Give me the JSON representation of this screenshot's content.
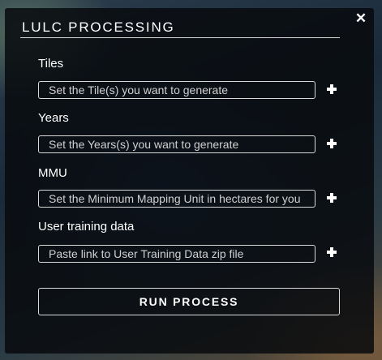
{
  "dialog": {
    "title": "LULC PROCESSING",
    "close_icon": "close-icon"
  },
  "fields": [
    {
      "label": "Tiles",
      "placeholder": "Set the Tile(s) you want to generate",
      "value": "",
      "add_icon": "plus-icon"
    },
    {
      "label": "Years",
      "placeholder": "Set the Years(s) you want to generate",
      "value": "",
      "add_icon": "plus-icon"
    },
    {
      "label": "MMU",
      "placeholder": "Set the Minimum Mapping Unit in hectares for you",
      "value": "",
      "add_icon": "plus-icon"
    },
    {
      "label": "User training data",
      "placeholder": "Paste link to User Training Data zip file",
      "value": "",
      "add_icon": "plus-icon"
    }
  ],
  "run_button": {
    "label": "RUN PROCESS"
  },
  "colors": {
    "panel_background": "#080a0e",
    "text": "#ffffff",
    "border": "#d9d9d9"
  }
}
